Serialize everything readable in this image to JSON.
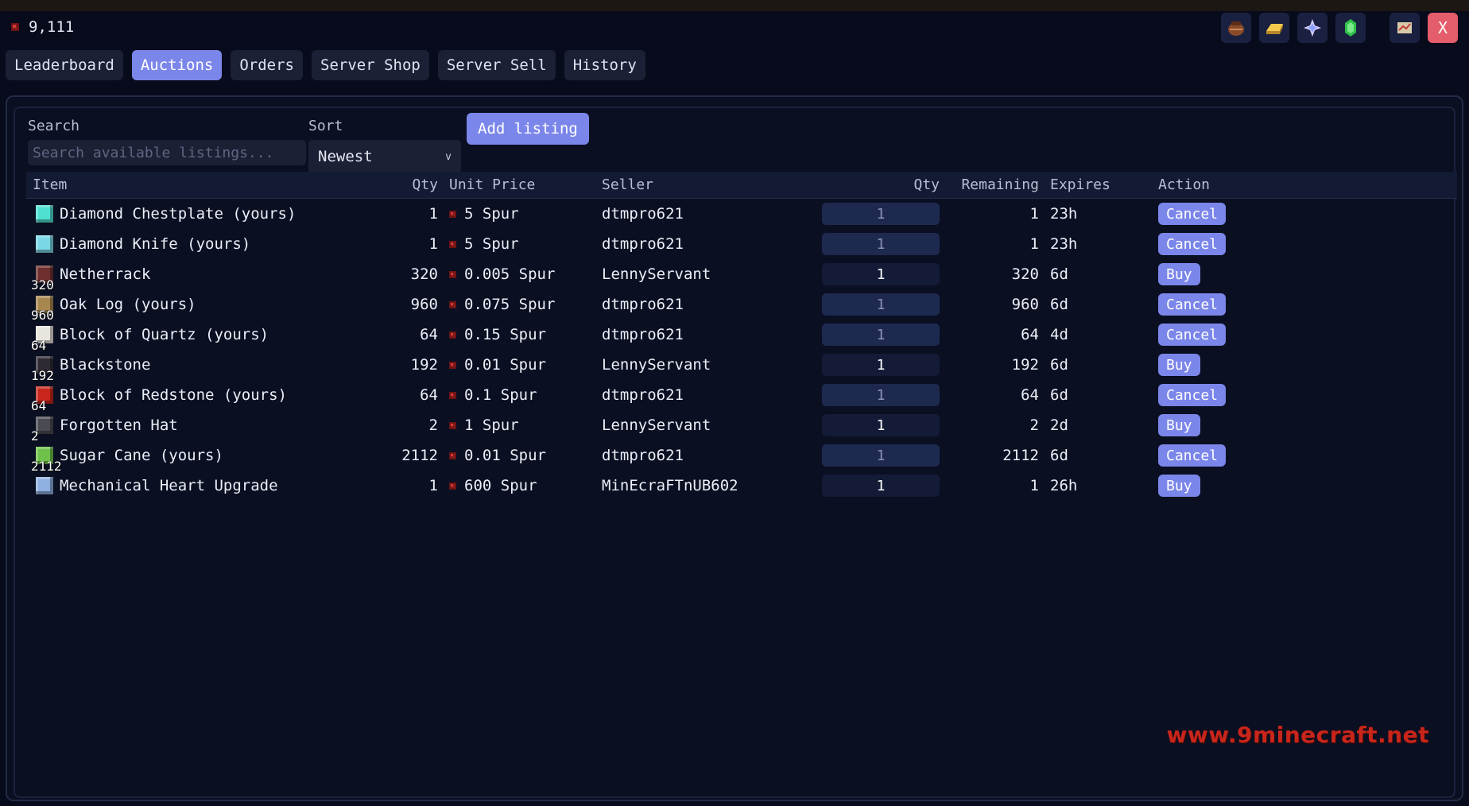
{
  "balance": {
    "amount": "9,111",
    "currency_icon": "spur-coin-icon"
  },
  "toolbar_icons": [
    {
      "name": "leather-pouch-icon",
      "color": "#8a4a2a"
    },
    {
      "name": "gold-ingot-icon",
      "color": "#e8b93a"
    },
    {
      "name": "star-icon",
      "color": "#c9b8ff"
    },
    {
      "name": "emerald-icon",
      "color": "#2fbf4a"
    },
    {
      "name": "map-icon",
      "color": "#c43b3b"
    }
  ],
  "close_label": "X",
  "tabs": [
    {
      "label": "Leaderboard",
      "active": false
    },
    {
      "label": "Auctions",
      "active": true
    },
    {
      "label": "Orders",
      "active": false
    },
    {
      "label": "Server Shop",
      "active": false
    },
    {
      "label": "Server Sell",
      "active": false
    },
    {
      "label": "History",
      "active": false
    }
  ],
  "filters": {
    "search_label": "Search",
    "search_placeholder": "Search available listings...",
    "search_value": "",
    "sort_label": "Sort",
    "sort_value": "Newest",
    "add_listing_label": "Add listing"
  },
  "columns": {
    "item": "Item",
    "qty": "Qty",
    "unit_price": "Unit Price",
    "seller": "Seller",
    "qty_input": "Qty",
    "remaining": "Remaining",
    "expires": "Expires",
    "action": "Action"
  },
  "listings": [
    {
      "item": "Diamond Chestplate (yours)",
      "icon": "diamond-chestplate-icon",
      "icon_color": "#4fe0d0",
      "stack": "",
      "qty": "1",
      "price": "5 Spur",
      "seller": "dtmpro621",
      "qty_input": "1",
      "editable": false,
      "remaining": "1",
      "expires": "23h",
      "action": "Cancel"
    },
    {
      "item": "Diamond Knife (yours)",
      "icon": "diamond-knife-icon",
      "icon_color": "#7ad8e6",
      "stack": "",
      "qty": "1",
      "price": "5 Spur",
      "seller": "dtmpro621",
      "qty_input": "1",
      "editable": false,
      "remaining": "1",
      "expires": "23h",
      "action": "Cancel"
    },
    {
      "item": "Netherrack",
      "icon": "netherrack-icon",
      "icon_color": "#6e2e2e",
      "stack": "320",
      "qty": "320",
      "price": "0.005 Spur",
      "seller": "LennyServant",
      "qty_input": "1",
      "editable": true,
      "remaining": "320",
      "expires": "6d",
      "action": "Buy"
    },
    {
      "item": "Oak Log (yours)",
      "icon": "oak-log-icon",
      "icon_color": "#a8874f",
      "stack": "960",
      "qty": "960",
      "price": "0.075 Spur",
      "seller": "dtmpro621",
      "qty_input": "1",
      "editable": false,
      "remaining": "960",
      "expires": "6d",
      "action": "Cancel"
    },
    {
      "item": "Block of Quartz (yours)",
      "icon": "quartz-block-icon",
      "icon_color": "#e8e4de",
      "stack": "64",
      "qty": "64",
      "price": "0.15 Spur",
      "seller": "dtmpro621",
      "qty_input": "1",
      "editable": false,
      "remaining": "64",
      "expires": "4d",
      "action": "Cancel"
    },
    {
      "item": "Blackstone",
      "icon": "blackstone-icon",
      "icon_color": "#2e2a33",
      "stack": "192",
      "qty": "192",
      "price": "0.01 Spur",
      "seller": "LennyServant",
      "qty_input": "1",
      "editable": true,
      "remaining": "192",
      "expires": "6d",
      "action": "Buy"
    },
    {
      "item": "Block of Redstone (yours)",
      "icon": "redstone-block-icon",
      "icon_color": "#c8261d",
      "stack": "64",
      "qty": "64",
      "price": "0.1 Spur",
      "seller": "dtmpro621",
      "qty_input": "1",
      "editable": false,
      "remaining": "64",
      "expires": "6d",
      "action": "Cancel"
    },
    {
      "item": "Forgotten Hat",
      "icon": "forgotten-hat-icon",
      "icon_color": "#4a4a52",
      "stack": "2",
      "qty": "2",
      "price": "1 Spur",
      "seller": "LennyServant",
      "qty_input": "1",
      "editable": true,
      "remaining": "2",
      "expires": "2d",
      "action": "Buy"
    },
    {
      "item": "Sugar Cane (yours)",
      "icon": "sugar-cane-icon",
      "icon_color": "#6ec24a",
      "stack": "2112",
      "qty": "2112",
      "price": "0.01 Spur",
      "seller": "dtmpro621",
      "qty_input": "1",
      "editable": false,
      "remaining": "2112",
      "expires": "6d",
      "action": "Cancel"
    },
    {
      "item": "Mechanical Heart Upgrade",
      "icon": "mechanical-heart-icon",
      "icon_color": "#8fb0e0",
      "stack": "",
      "qty": "1",
      "price": "600 Spur",
      "seller": "MinEcraFTnUB602",
      "qty_input": "1",
      "editable": true,
      "remaining": "1",
      "expires": "26h",
      "action": "Buy"
    }
  ],
  "watermark": "www.9minecraft.net",
  "colors": {
    "accent": "#7b86ea",
    "background": "#070b1c",
    "panel": "#0a0f21",
    "coin": "#d23a3a",
    "close": "#e35d6a"
  }
}
